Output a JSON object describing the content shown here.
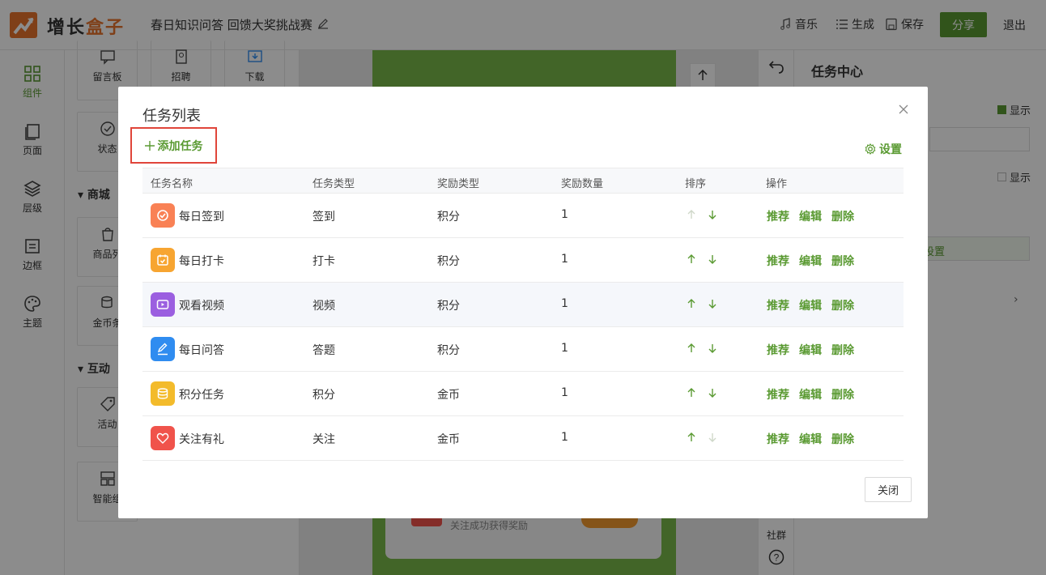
{
  "header": {
    "logo_text_a": "增长",
    "logo_text_b": "盒子",
    "project_title": "春日知识问答 回馈大奖挑战赛",
    "music": "音乐",
    "generate": "生成",
    "save": "保存",
    "share": "分享",
    "logout": "退出"
  },
  "leftnav": [
    "组件",
    "页面",
    "层级",
    "边框",
    "主题"
  ],
  "components": {
    "row1": [
      "留言板",
      "招聘",
      "下载"
    ],
    "state": "状态",
    "section_mall": "商城",
    "product": "商品列",
    "coin": "金币条",
    "section_interact": "互动",
    "activity": "活动",
    "smart": "智能组"
  },
  "right_panel": {
    "title": "任务中心",
    "show1": "显示",
    "show2": "显示",
    "settings_fragment": "设置",
    "community": "社群"
  },
  "canvas": {
    "follow_hint": "关注成功获得奖励"
  },
  "modal": {
    "title": "任务列表",
    "add_task": "添加任务",
    "settings": "设置",
    "close": "关闭",
    "columns": [
      "任务名称",
      "任务类型",
      "奖励类型",
      "奖励数量",
      "排序",
      "操作"
    ],
    "ops": [
      "推荐",
      "编辑",
      "删除"
    ],
    "rows": [
      {
        "name": "每日签到",
        "type": "签到",
        "reward": "积分",
        "count": "1",
        "icon": "check-circle-icon",
        "color": "#f98155"
      },
      {
        "name": "每日打卡",
        "type": "打卡",
        "reward": "积分",
        "count": "1",
        "icon": "calendar-check-icon",
        "color": "#f7a531"
      },
      {
        "name": "观看视频",
        "type": "视频",
        "reward": "积分",
        "count": "1",
        "icon": "video-icon",
        "color": "#9b5fe0"
      },
      {
        "name": "每日问答",
        "type": "答题",
        "reward": "积分",
        "count": "1",
        "icon": "pen-icon",
        "color": "#2f8cf0"
      },
      {
        "name": "积分任务",
        "type": "积分",
        "reward": "金币",
        "count": "1",
        "icon": "coins-icon",
        "color": "#f3bb2b"
      },
      {
        "name": "关注有礼",
        "type": "关注",
        "reward": "金币",
        "count": "1",
        "icon": "heart-icon",
        "color": "#f0534b"
      }
    ]
  },
  "colors": {
    "accent": "#5a9a32",
    "highlight_border": "#e0453a"
  }
}
